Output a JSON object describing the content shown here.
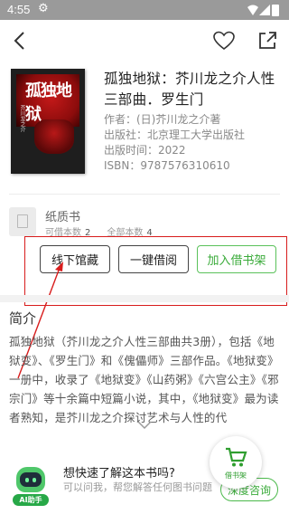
{
  "status_bar": {
    "time": "4:55"
  },
  "book": {
    "title": "孤独地狱：芥川龙之介人性三部曲．罗生门",
    "author": "作者：(日)芥川龙之介著",
    "publisher": "出版社：北京理工大学出版社",
    "pub_date": "出版时间：2022",
    "isbn": "ISBN：9787576310610",
    "cover_title": "孤独地狱",
    "cover_subtitle": "芥川龙之介"
  },
  "paper": {
    "label": "纸质书",
    "available_label": "可借本数",
    "available_count": "2",
    "total_label": "全部本数",
    "total_count": "4"
  },
  "actions": {
    "offline": "线下馆藏",
    "borrow": "一键借阅",
    "shelf": "加入借书架"
  },
  "intro": {
    "title": "简介",
    "text": "孤独地狱（芥川龙之介人性三部曲共3册），包括《地狱变》、《罗生门》和《傀儡师》三部作品。《地狱变》一册中，收录了《地狱变》《山药粥》《六宫公主》《邪宗门》等十余篇中短篇小说，其中，《地狱变》最为读者熟知，是芥川龙之介探讨艺术与人性的代"
  },
  "promo": {
    "ai_label": "AI助手",
    "question": "想快速了解这本书吗?",
    "subtext": "可以问我，帮您解答任何图书问题",
    "consult": "深度咨询"
  },
  "fab": {
    "label": "借书架"
  },
  "colors": {
    "accent_green": "#3aab3a",
    "highlight_red": "#d81c1c"
  }
}
